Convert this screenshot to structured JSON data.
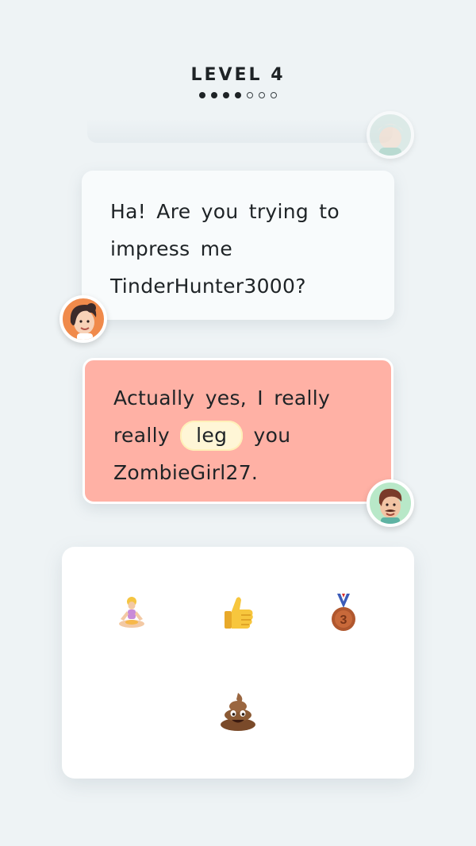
{
  "header": {
    "level_label": "LEVEL 4",
    "progress": {
      "filled": 4,
      "total": 7
    }
  },
  "conversation": {
    "npc_message": "Ha! Are you trying to impress me TinderHunter3000?",
    "player_message": {
      "before": "Actually yes, I really really",
      "highlighted_word": "leg",
      "after": "you ZombieGirl27."
    }
  },
  "emoji_options": [
    {
      "icon": "lotus-position-person-icon"
    },
    {
      "icon": "thumbs-up-icon"
    },
    {
      "icon": "third-place-medal-icon",
      "medal_number": "3"
    },
    {
      "icon": "pile-of-poo-icon"
    }
  ],
  "colors": {
    "background": "#eef3f5",
    "npc_bubble": "#f8fbfc",
    "player_bubble": "#ffb1a5",
    "highlight_chip": "#fff6d6",
    "text": "#1e2326"
  }
}
